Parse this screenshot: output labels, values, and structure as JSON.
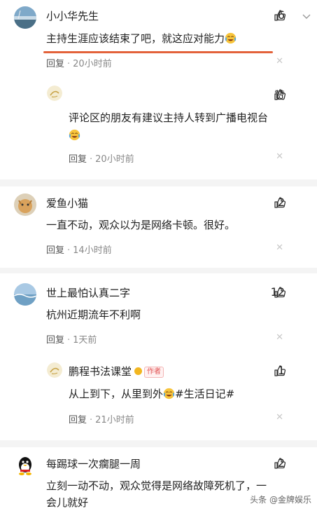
{
  "comments": [
    {
      "name": "小小华先生",
      "likes": "6",
      "text": "主持生涯应该结束了吧，就这应对能力",
      "reply_label": "回复",
      "time": "20小时前",
      "reply": {
        "likes": "赞",
        "text_line1": "评论区的朋友有建议主持人转到广播电视台",
        "reply_label": "回复",
        "time": "20小时前"
      }
    },
    {
      "name": "爱鱼小猫",
      "likes": "2",
      "text": "一直不动，观众以为是网络卡顿。很好。",
      "reply_label": "回复",
      "time": "14小时前"
    },
    {
      "name": "世上最怕认真二字",
      "likes": "12",
      "text": "杭州近期流年不利啊",
      "reply_label": "回复",
      "time": "1天前",
      "reply": {
        "name": "鹏程书法课堂",
        "author_badge": "作者",
        "likes": "1",
        "text_before": "从上到下，从里到外",
        "text_after": "#生活日记#",
        "reply_label": "回复",
        "time": "21小时前"
      }
    },
    {
      "name": "每踢球一次瘸腿一周",
      "likes": "2",
      "text_line1": "立刻一动不动，观众觉得是网络故障死机了，一",
      "text_line2": "会儿就好"
    }
  ],
  "watermark": "头条 @金牌娱乐",
  "icons": {
    "like": "thumbs-up-icon",
    "more": "chevron-down-icon",
    "close": "close-icon",
    "emoji": "laughing-crying-emoji-icon"
  },
  "colors": {
    "underline": "#e3623a",
    "author_badge": "#e05050",
    "vip_badge": "#f2b620"
  }
}
